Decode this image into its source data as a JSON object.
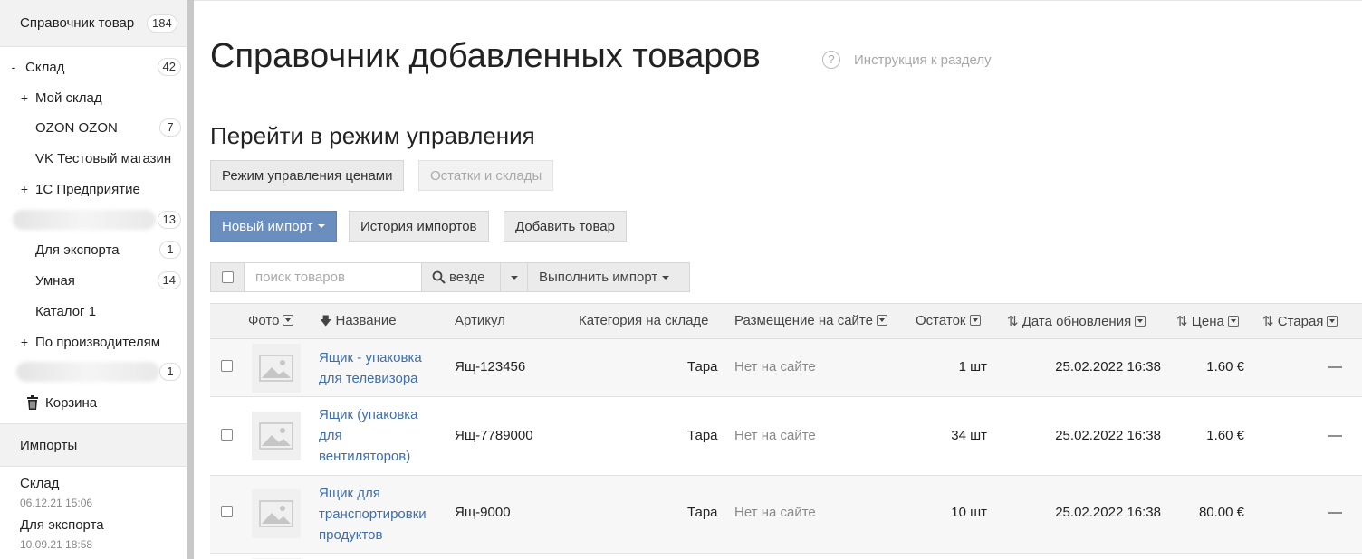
{
  "sidebar": {
    "header": {
      "label": "Справочник товар",
      "count": "184"
    },
    "tree": [
      {
        "prefix": "-",
        "label": "Склад",
        "count": "42"
      },
      {
        "prefix": "+",
        "label": "Мой склад",
        "count": ""
      },
      {
        "prefix": "",
        "label": "OZON OZON",
        "count": "7"
      },
      {
        "prefix": "",
        "label": "VK Тестовый магазин",
        "count": ""
      },
      {
        "prefix": "+",
        "label": "1С Предприятие",
        "count": ""
      },
      {
        "prefix": "",
        "label": "",
        "count": "13"
      },
      {
        "prefix": "",
        "label": "Для экспорта",
        "count": "1"
      },
      {
        "prefix": "",
        "label": "Умная",
        "count": "14"
      },
      {
        "prefix": "",
        "label": "Каталог 1",
        "count": ""
      },
      {
        "prefix": "+",
        "label": "По производителям",
        "count": ""
      },
      {
        "prefix": "",
        "label": "",
        "count": "1"
      }
    ],
    "trash_label": "Корзина",
    "imports_title": "Импорты",
    "imports": [
      {
        "name": "Склад",
        "date": "06.12.21 15:06"
      },
      {
        "name": "Для экспорта",
        "date": "10.09.21 18:58"
      }
    ]
  },
  "main": {
    "title": "Справочник добавленных товаров",
    "help_link": "Инструкция к разделу",
    "help_icon": "?",
    "subtitle": "Перейти в режим управления",
    "mode_buttons": [
      "Режим управления ценами",
      "Остатки и склады"
    ],
    "actions": {
      "new_import": "Новый импорт",
      "history": "История импортов",
      "add_product": "Добавить товар"
    },
    "toolbar": {
      "search_placeholder": "поиск товаров",
      "scope": "везде",
      "run_import": "Выполнить импорт"
    },
    "columns": {
      "photo": "Фото",
      "name": "Название",
      "sku": "Артикул",
      "category": "Категория на складе",
      "placement": "Размещение на сайте",
      "stock": "Остаток",
      "updated": "Дата обновления",
      "price": "Цена",
      "old": "Старая"
    },
    "rows": [
      {
        "name": "Ящик - упаковка для телевизора",
        "sku": "Ящ-123456",
        "category": "Тара",
        "placement": "Нет на сайте",
        "stock": "1 шт",
        "updated": "25.02.2022 16:38",
        "price": "1.60 €",
        "old": "—"
      },
      {
        "name": "Ящик (упаковка для вентиляторов)",
        "sku": "Ящ-7789000",
        "category": "Тара",
        "placement": "Нет на сайте",
        "stock": "34 шт",
        "updated": "25.02.2022 16:38",
        "price": "1.60 €",
        "old": "—"
      },
      {
        "name": "Ящик для транспортировки продуктов",
        "sku": "Ящ-9000",
        "category": "Тара",
        "placement": "Нет на сайте",
        "stock": "10 шт",
        "updated": "25.02.2022 16:38",
        "price": "80.00 €",
        "old": "—"
      }
    ]
  },
  "colors": {
    "primary_button": "#6a8ebe",
    "link": "#3f6ea8",
    "muted": "#a8a8a8"
  }
}
